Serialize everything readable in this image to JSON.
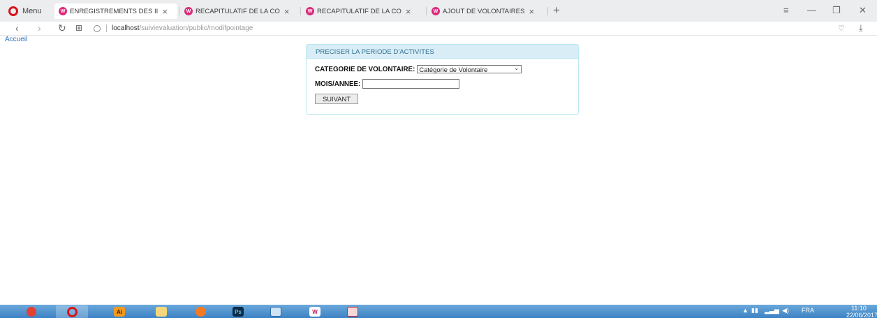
{
  "browser": {
    "menu_label": "Menu",
    "tabs": [
      {
        "title": "ENREGISTREMENTS DES II",
        "active": true
      },
      {
        "title": "RECAPITULATIF DE LA CO",
        "active": false
      },
      {
        "title": "RECAPITULATIF DE LA CO",
        "active": false
      },
      {
        "title": "AJOUT DE VOLONTAIRES",
        "active": false
      }
    ],
    "tab_close": "×",
    "new_tab": "+",
    "url_host": "localhost",
    "url_path": "/suivievaluation/public/modifpointage"
  },
  "page": {
    "home_link": "Accueil",
    "panel_title": "PRECISER LA PERIODE D'ACTIVITES",
    "category_label": "CATEGORIE DE VOLONTAIRE:",
    "category_selected": "Catégorie de Volontaire",
    "month_label": "MOIS/ANNEE:",
    "month_value": "",
    "submit_label": "SUIVANT"
  },
  "taskbar": {
    "apps": [
      "chrome-icon",
      "opera-icon",
      "illustrator-icon",
      "file-explorer-icon",
      "firefox-icon",
      "photoshop-icon",
      "notepad-icon",
      "wamp-icon",
      "xmind-icon"
    ],
    "illustrator_text": "Ai",
    "photoshop_text": "Ps",
    "language": "FRA",
    "time": "11:10",
    "date": "22/06/2017"
  },
  "colors": {
    "panel_heading_bg": "#d9edf7",
    "panel_border": "#bce8f1",
    "panel_heading_text": "#31708f",
    "link": "#2a6fb5",
    "tab_favicon": "#dd2a7b",
    "taskbar": "#4a8fcf"
  }
}
